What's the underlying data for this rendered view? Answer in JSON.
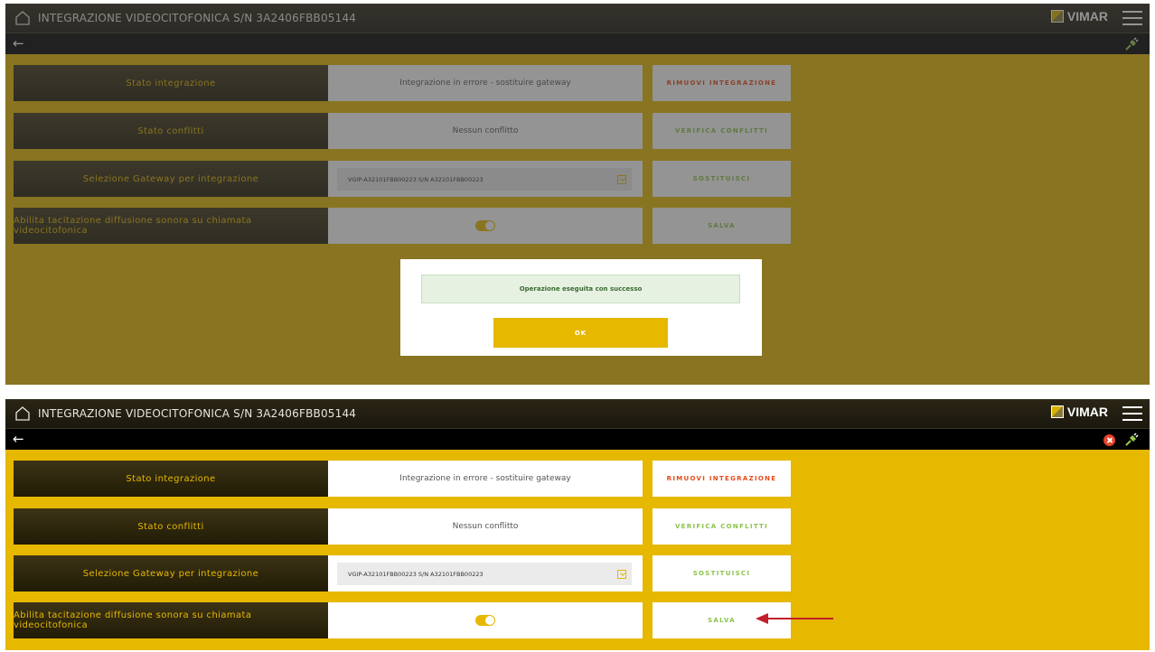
{
  "header": {
    "title": "INTEGRAZIONE VIDEOCITOFONICA S/N 3A2406FBB05144",
    "brand": "VIMAR",
    "icons": [
      "home-icon",
      "menu-icon",
      "back-arrow-icon",
      "error-icon",
      "plug-icon"
    ]
  },
  "rows": {
    "stato_integrazione": {
      "label": "Stato integrazione",
      "value": "Integrazione in errore - sostituire gateway",
      "action": "RIMUOVI INTEGRAZIONE"
    },
    "stato_conflitti": {
      "label": "Stato conflitti",
      "value": "Nessun conflitto",
      "action": "VERIFICA CONFLITTI"
    },
    "gateway": {
      "label": "Selezione Gateway per integrazione",
      "value": "VGIP-A32101FBB00223 S/N A32101FBB00223",
      "action": "SOSTITUISCI"
    },
    "tacitazione": {
      "label": "Abilita tacitazione diffusione sonora su chiamata videocitofonica",
      "toggle_on": true,
      "action": "SALVA"
    }
  },
  "modal": {
    "message": "Operazione eseguita con successo",
    "ok_label": "OK"
  },
  "colors": {
    "accent": "#e6b800",
    "header_dark": "#1a170d",
    "danger": "#e64a19",
    "success_text": "#8bc34a"
  },
  "back_symbol": "←"
}
